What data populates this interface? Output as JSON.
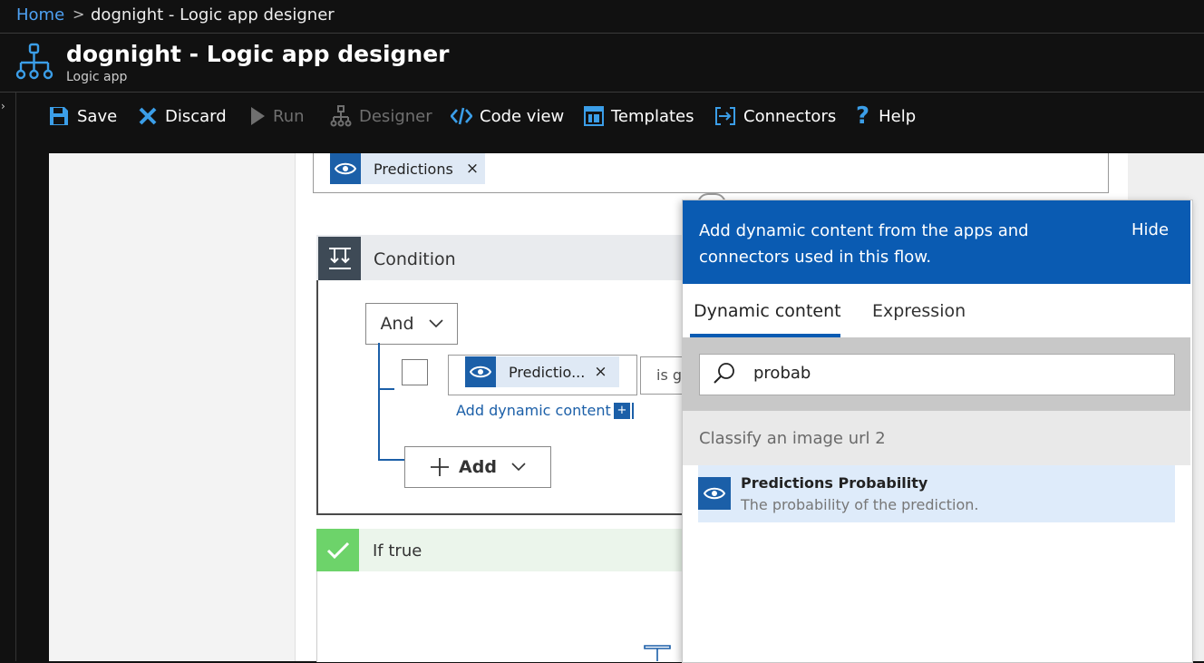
{
  "breadcrumb": {
    "home": "Home",
    "separator": ">",
    "current": "dognight - Logic app designer"
  },
  "header": {
    "title": "dognight - Logic app designer",
    "subtitle": "Logic app"
  },
  "toolbar": {
    "save": "Save",
    "discard": "Discard",
    "run": "Run",
    "designer": "Designer",
    "code_view": "Code view",
    "templates": "Templates",
    "connectors": "Connectors",
    "help": "Help"
  },
  "canvas": {
    "pred_token": "Predictions",
    "token_close": "×",
    "condition": {
      "title": "Condition",
      "group_operator": "And",
      "value_token": "Predictio...",
      "operator_text": "is g",
      "add_dynamic": "Add dynamic content",
      "add_dynamic_plus": "+",
      "add_button": "Add"
    },
    "if_true": {
      "title": "If true"
    }
  },
  "dynamic_panel": {
    "message": "Add dynamic content from the apps and connectors used in this flow.",
    "hide": "Hide",
    "tabs": [
      "Dynamic content",
      "Expression"
    ],
    "search_value": "probab",
    "group_title": "Classify an image url 2",
    "items": [
      {
        "name": "Predictions Probability",
        "description": "The probability of the prediction."
      }
    ]
  },
  "colors": {
    "accent": "#0a5bb2",
    "token_bg": "#dfe9f5",
    "success": "#6dd36a"
  }
}
